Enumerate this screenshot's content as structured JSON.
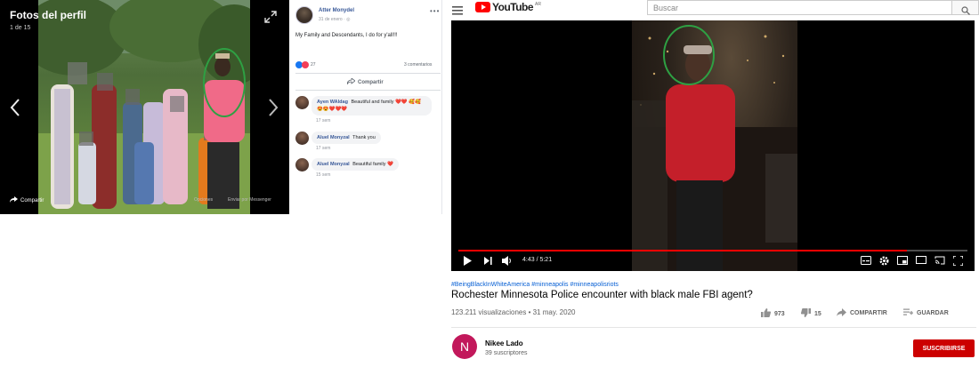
{
  "facebook": {
    "viewer": {
      "title": "Fotos del perfil",
      "counter": "1 de 15",
      "share_label": "Compartir",
      "options_label": "Opciones",
      "messenger_label": "Enviar por Messenger",
      "icons": [
        "expand-icon",
        "arrow-left-icon",
        "arrow-right-icon",
        "share-icon"
      ]
    },
    "post": {
      "author": "Atter Monydel",
      "date": "31 de enero · ◎",
      "text": "My Family and Descendants, I do for y'all!!!",
      "reactions_count": "27",
      "comments_count": "3 comentarios",
      "share_label": "Compartir",
      "comments": [
        {
          "name": "Ayen WAldag",
          "text": "Beautiful and family ❤️❤️ 🥰🥰😍😍❤️❤️❤️",
          "time": "17 sem"
        },
        {
          "name": "Aluel Monyzal",
          "text": "Thank you",
          "time": "17 sem"
        },
        {
          "name": "Aluel Monyzal",
          "text": "Beautiful family ❤️",
          "time": "15 sem"
        }
      ]
    }
  },
  "youtube": {
    "logo": "YouTube",
    "country": "AR",
    "search_placeholder": "Buscar",
    "player": {
      "current_time": "4:43",
      "duration": "5:21",
      "time_display": "4:43 / 5:21",
      "progress_fraction": 0.881
    },
    "video": {
      "tags": "#BeingBlackInWhiteAmerica #minneapolis #minneapolisriots",
      "title": "Rochester Minnesota Police encounter with black male FBI agent?",
      "views_date": "123.211 visualizaciones • 31 may. 2020",
      "likes": "973",
      "dislikes": "15",
      "share_label": "COMPARTIR",
      "save_label": "GUARDAR"
    },
    "channel": {
      "initial": "N",
      "name": "Nikee Lado",
      "subscribers": "39 suscriptores",
      "subscribe_label": "SUSCRIBIRSE"
    }
  },
  "colors": {
    "yt_red": "#ff0000",
    "subscribe_red": "#cc0000",
    "fb_link_blue": "#385898",
    "annotation_green": "#2ea043",
    "channel_avatar": "#c2185b"
  }
}
